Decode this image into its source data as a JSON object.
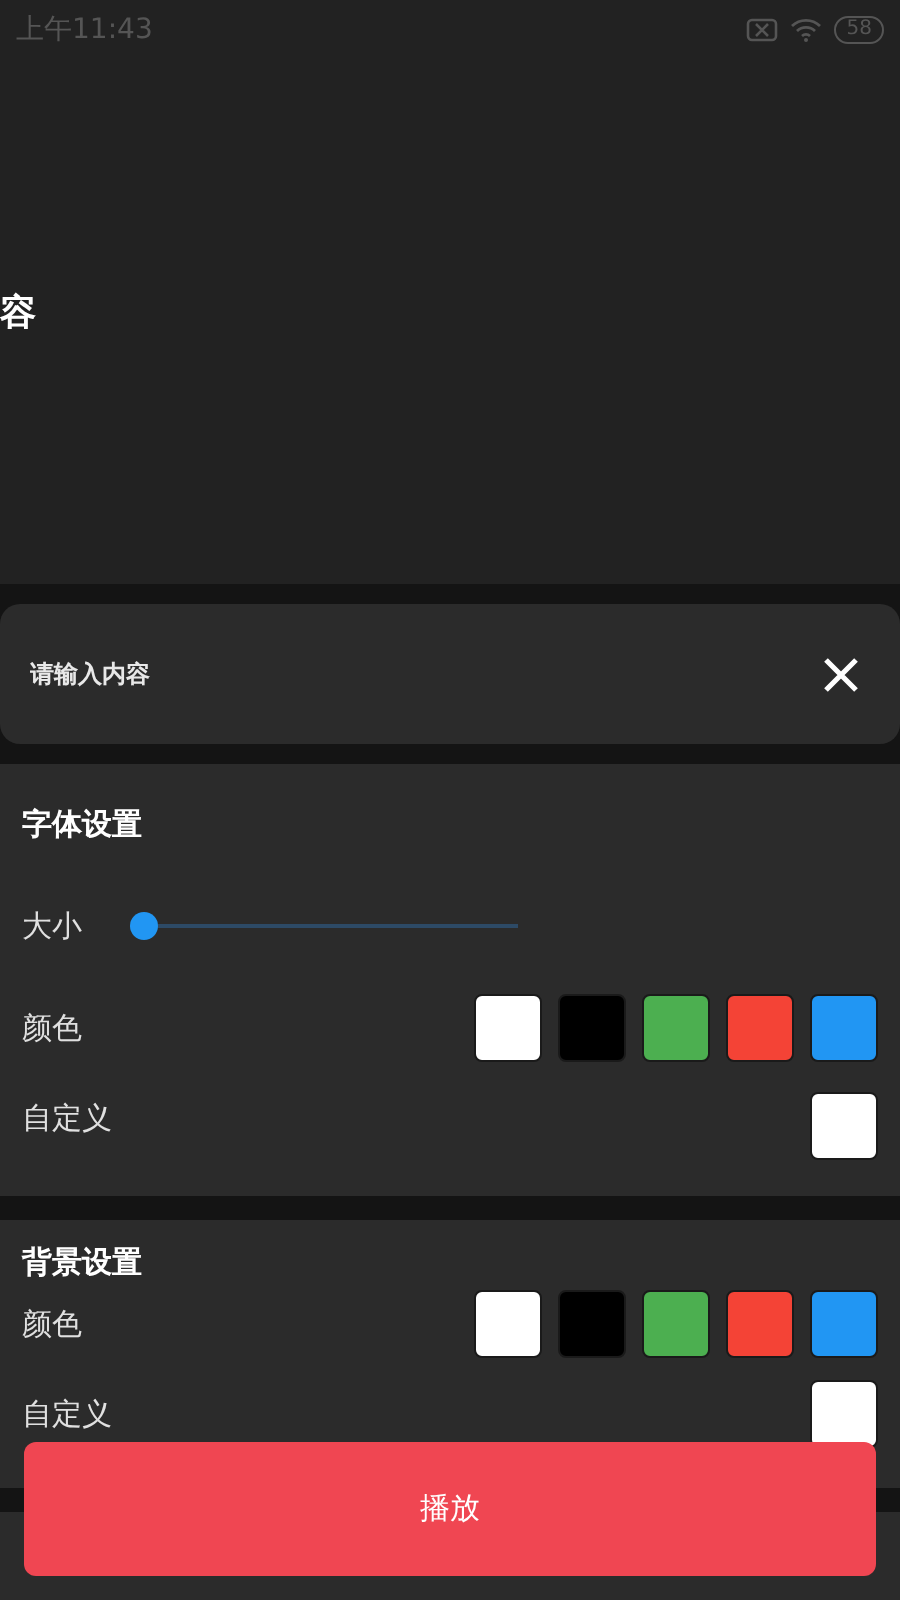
{
  "status_bar": {
    "time": "上午11:43",
    "battery": "58"
  },
  "preview": {
    "text": "容"
  },
  "input": {
    "placeholder": "请输入内容"
  },
  "font_settings": {
    "title": "字体设置",
    "size": {
      "label": "大小",
      "level": 0
    },
    "color": {
      "label": "颜色",
      "swatches": [
        {
          "color": "#ffffff"
        },
        {
          "color": "#000000"
        },
        {
          "color": "#4caf50"
        },
        {
          "color": "#f44336"
        },
        {
          "color": "#2196f3"
        }
      ]
    },
    "custom": {
      "label": "自定义",
      "color": "#ffffff"
    }
  },
  "background_settings": {
    "title": "背景设置",
    "color": {
      "label": "颜色",
      "swatches": [
        {
          "color": "#ffffff"
        },
        {
          "color": "#000000"
        },
        {
          "color": "#4caf50"
        },
        {
          "color": "#f44336"
        },
        {
          "color": "#2196f3"
        }
      ]
    },
    "custom": {
      "label": "自定义",
      "color": "#ffffff"
    }
  },
  "play_button": {
    "label": "播放"
  }
}
